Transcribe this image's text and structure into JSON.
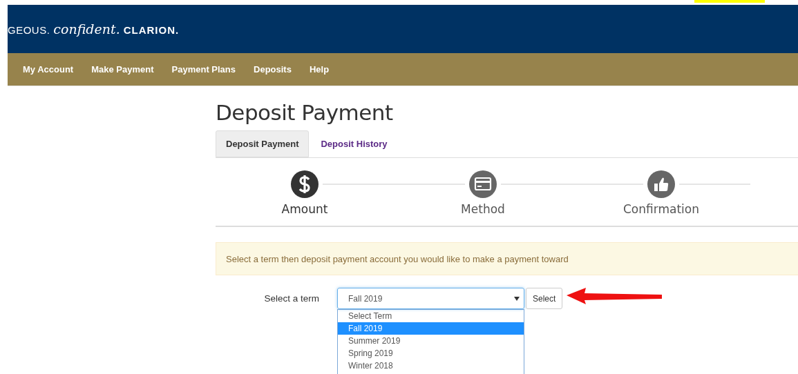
{
  "logo": {
    "parts": [
      "GEOUS.",
      "confident.",
      "CLARION."
    ]
  },
  "nav": {
    "items": [
      "My Account",
      "Make Payment",
      "Payment Plans",
      "Deposits",
      "Help"
    ]
  },
  "page": {
    "title": "Deposit Payment"
  },
  "tabs": [
    {
      "label": "Deposit Payment",
      "selected": true
    },
    {
      "label": "Deposit History",
      "selected": false
    }
  ],
  "steps": [
    {
      "label": "Amount",
      "kind": "dollar",
      "active": true
    },
    {
      "label": "Method",
      "kind": "card",
      "active": false
    },
    {
      "label": "Confirmation",
      "kind": "thumb",
      "active": false
    }
  ],
  "alert": {
    "text": "Select a term then deposit payment account you would like to make a payment toward"
  },
  "form": {
    "label": "Select a term",
    "value": "Fall 2019",
    "button": "Select",
    "options": [
      {
        "label": "Select Term",
        "selected": false
      },
      {
        "label": "Fall 2019",
        "selected": true
      },
      {
        "label": "Summer 2019",
        "selected": false
      },
      {
        "label": "Spring 2019",
        "selected": false
      },
      {
        "label": "Winter 2018",
        "selected": false
      }
    ]
  }
}
